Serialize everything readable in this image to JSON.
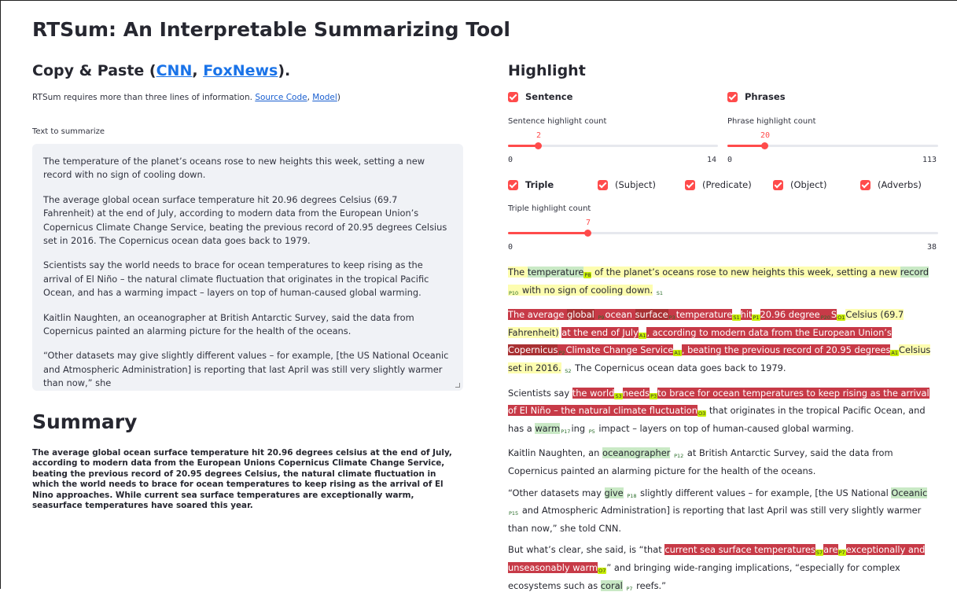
{
  "app": {
    "title": "RTSum: An Interpretable Summarizing Tool"
  },
  "left": {
    "copy_heading_prefix": "Copy & Paste (",
    "link_cnn": "CNN",
    "sep": ", ",
    "link_foxnews": "FoxNews",
    "copy_heading_suffix": ").",
    "info_text": "RTSum requires more than three lines of information. ",
    "link_source_code": "Source Code",
    "link_model": "Model",
    "info_suffix": ")",
    "textarea_label": "Text to summarize",
    "paragraphs": [
      "The temperature of the planet’s oceans rose to new heights this week, setting a new record with no sign of cooling down.",
      "The average global ocean surface temperature hit 20.96 degrees Celsius (69.7 Fahrenheit) at the end of July, according to modern data from the European Union’s Copernicus Climate Change Service, beating the previous record of 20.95 degrees Celsius set in 2016. The Copernicus ocean data goes back to 1979.",
      "Scientists say the world needs to brace for ocean temperatures to keep rising as the arrival of El Niño – the natural climate fluctuation that originates in the tropical Pacific Ocean, and has a warming impact – layers on top of human-caused global warming.",
      "Kaitlin Naughten, an oceanographer at British Antarctic Survey, said the data from Copernicus painted an alarming picture for the health of the oceans.",
      "“Other datasets may give slightly different values – for example, [the US National Oceanic and Atmospheric Administration] is reporting that last April was still very slightly warmer than now,” she"
    ],
    "summary_heading": "Summary",
    "summary_text": "The average global ocean surface temperature hit 20.96 degrees celsius at the end of July, according to modern data from the European Unions Copernicus Climate Change Service, beating the previous record of 20.95 degrees Celsius, the natural climate fluctuation in which the world needs to brace for ocean temperatures to keep rising as the arrival of El Nino approaches. While current sea surface temperatures are exceptionally warm, seasurface temperatures have soared this year."
  },
  "right": {
    "heading": "Highlight",
    "cb_sentence": "Sentence",
    "cb_phrases": "Phrases",
    "sentence_slider": {
      "label": "Sentence highlight count",
      "value": "2",
      "min": "0",
      "max": "14",
      "fraction": 0.143
    },
    "phrase_slider": {
      "label": "Phrase highlight count",
      "value": "20",
      "min": "0",
      "max": "113",
      "fraction": 0.177
    },
    "cb_triple": "Triple",
    "cb_subject": "(Subject)",
    "cb_predicate": "(Predicate)",
    "cb_object": "(Object)",
    "cb_adverbs": "(Adverbs)",
    "triple_slider": {
      "label": "Triple highlight count",
      "value": "7",
      "min": "0",
      "max": "38",
      "fraction": 0.184
    }
  }
}
